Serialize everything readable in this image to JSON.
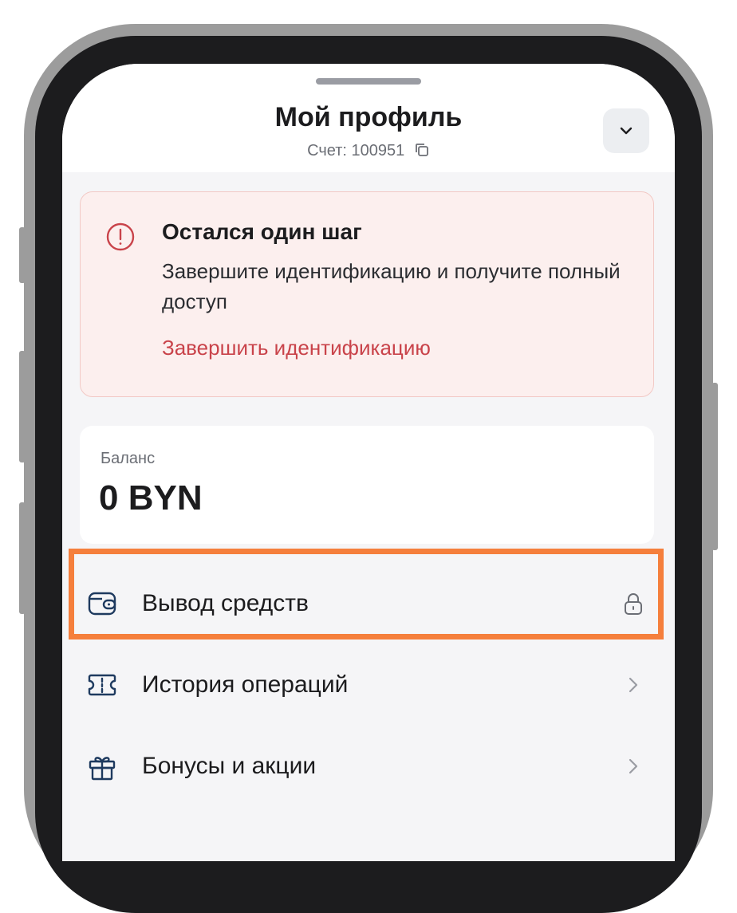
{
  "header": {
    "title": "Мой профиль",
    "account": "Счет: 100951"
  },
  "alert": {
    "title": "Остался один шаг",
    "text": "Завершите идентификацию и получите полный доступ",
    "link": "Завершить идентификацию"
  },
  "balance": {
    "label": "Баланс",
    "value": "0 BYN"
  },
  "menu": [
    {
      "label": "Вывод средств",
      "icon": "wallet-icon",
      "right": "lock-icon"
    },
    {
      "label": "История операций",
      "icon": "ticket-icon",
      "right": "chevron-right-icon"
    },
    {
      "label": "Бонусы и акции",
      "icon": "gift-icon",
      "right": "chevron-right-icon"
    }
  ],
  "colors": {
    "accent_red": "#c9434a",
    "alert_bg": "#fcefee",
    "highlight": "#f57f3c",
    "icon_blue": "#1e3a5f"
  }
}
